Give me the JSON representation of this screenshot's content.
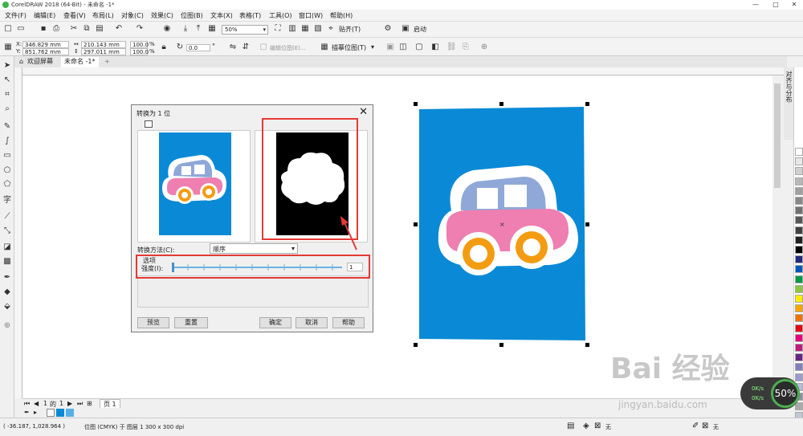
{
  "window": {
    "title": "CorelDRAW 2018 (64-Bit) - 未命名 -1*",
    "controls": [
      "—",
      "□",
      "✕"
    ]
  },
  "menu": [
    "文件(F)",
    "编辑(E)",
    "查看(V)",
    "布局(L)",
    "对象(C)",
    "效果(C)",
    "位图(B)",
    "文本(X)",
    "表格(T)",
    "工具(O)",
    "窗口(W)",
    "帮助(H)"
  ],
  "toolbar": {
    "zoom": "50%",
    "snap_label": "贴齐(T)",
    "launch_label": "启动"
  },
  "property_bar": {
    "x": "346.829 mm",
    "y": "851.762 mm",
    "width": "210.143 mm",
    "height": "297.011 mm",
    "scale_w": "100.0",
    "scale_h": "100.0",
    "scale_unit": "%",
    "rotation": "0.0",
    "edit_bitmap": "编辑位图(E)...",
    "trace_bitmap": "描摹位图(T)"
  },
  "tabs": {
    "welcome": "欢迎屏幕",
    "document": "未命名 -1*",
    "add": "+"
  },
  "dialog": {
    "title": "转换为 1 位",
    "method_label": "转换方法(C):",
    "method_value": "顺序",
    "options_label": "选项",
    "strength_label": "强度(I):",
    "strength_value": "1",
    "buttons": {
      "preview": "预览",
      "reset": "重置",
      "ok": "确定",
      "cancel": "取消",
      "help": "帮助"
    }
  },
  "page_nav": {
    "current": "1",
    "of": "的",
    "total": "1",
    "page_tab": "页 1"
  },
  "status": {
    "coords": "( -36.187, 1,028.964 )",
    "object_info": "位图 (CMYK) 于 图层 1 300 x 300 dpi",
    "fill_none": "无",
    "outline_none": "无"
  },
  "docker": {
    "tab_label": "对齐与分布"
  },
  "watermark": {
    "text": "Bai 经验",
    "url": "jingyan.baidu.com"
  },
  "zoom_widget": {
    "percent": "50%",
    "up": "0K/s",
    "down": "0K/s"
  },
  "palette": [
    "#ffffff",
    "#e8e8e8",
    "#d0d0d0",
    "#b8b8b8",
    "#a0a0a0",
    "#888888",
    "#707070",
    "#585858",
    "#404040",
    "#202020",
    "#000000",
    "#1f2a7a",
    "#0057b8",
    "#009a44",
    "#8cc63f",
    "#ffeb00",
    "#f7a600",
    "#ee7203",
    "#e30613",
    "#e6007e",
    "#bd1c7e",
    "#662483",
    "#7f7fbf",
    "#9b9bd0",
    "#b9b9e0",
    "#8e8ea8",
    "#aaaaaa",
    "#c0c8d8",
    "#9fb4d0",
    "#7ba0c8",
    "#5a8cc0"
  ]
}
